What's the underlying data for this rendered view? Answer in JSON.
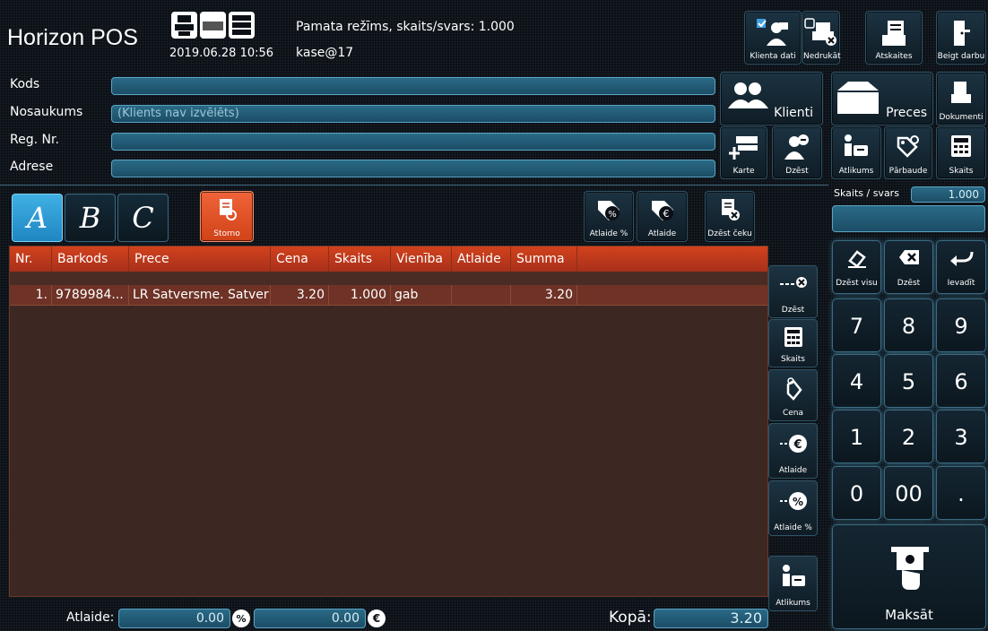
{
  "header": {
    "app_title": "Horizon POS",
    "datetime": "2019.06.28 10:56",
    "mode_text": "Pamata režīms, skaits/svars: 1.000",
    "user": "kase@17",
    "buttons": {
      "client_data": "Klienta dati",
      "no_print": "Nedrukāt",
      "reports": "Atskaites",
      "end_work": "Beigt darbu"
    }
  },
  "customer_form": {
    "code_label": "Kods",
    "name_label": "Nosaukums",
    "reg_label": "Reg. Nr.",
    "address_label": "Adrese",
    "code_value": "",
    "name_value": "(Klients nav izvēlēts)",
    "reg_value": "",
    "address_value": ""
  },
  "action_tiles": {
    "clients": "Klienti",
    "goods": "Preces",
    "documents": "Dokumenti",
    "card": "Karte",
    "delete": "Dzēst",
    "return": "Atlikums",
    "check": "Pārbaude",
    "quantity": "Skaits"
  },
  "toolbar": {
    "tabs": [
      "A",
      "B",
      "C"
    ],
    "storno": "Storno",
    "discount_pct": "Atlaide %",
    "discount": "Atlaide",
    "delete_receipt": "Dzēst čeku"
  },
  "table": {
    "columns": [
      "Nr.",
      "Barkods",
      "Prece",
      "Cena",
      "Skaits",
      "Vienība",
      "Atlaide",
      "Summa"
    ],
    "rows": [
      {
        "nr": "1.",
        "barcode": "9789984...",
        "item": "LR Satversme. Satver",
        "price": "3.20",
        "qty": "1.000",
        "unit": "gab",
        "discount": "",
        "sum": "3.20"
      }
    ]
  },
  "side_buttons": {
    "delete": "Dzēst",
    "quantity": "Skaits",
    "price": "Cena",
    "discount": "Atlaide",
    "discount_pct": "Atlaide %",
    "return": "Atlikums"
  },
  "keypad": {
    "qty_label": "Skaits / svars",
    "qty_value": "1.000",
    "input_value": "",
    "clear_all": "Dzēst visu",
    "backspace": "Dzēst",
    "enter": "Ievadīt",
    "keys": [
      "7",
      "8",
      "9",
      "4",
      "5",
      "6",
      "1",
      "2",
      "3",
      "0",
      "00",
      "."
    ],
    "pay": "Maksāt"
  },
  "footer": {
    "discount_label": "Atlaide:",
    "discount_pct_value": "0.00",
    "discount_eur_value": "0.00",
    "total_label": "Kopā:",
    "total_value": "3.20"
  },
  "colors": {
    "accent_blue": "#3fb0e4",
    "header_orange": "#d2421d",
    "row_brown": "#6e3226",
    "storno_orange": "#e8542a"
  }
}
